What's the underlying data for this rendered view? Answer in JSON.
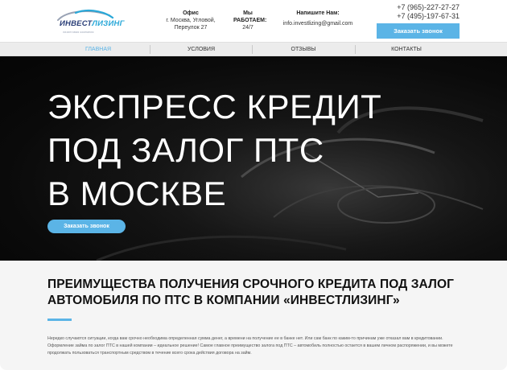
{
  "header": {
    "logo": {
      "name": "ИНВЕСТЛИЗИНГ",
      "part_main": "ИНВЕСТ",
      "part_accent": "ЛИЗИНГ",
      "tagline": "лизинговая компания"
    },
    "office": {
      "title": "Офис",
      "line1": "г. Москва, Угловой,",
      "line2": "Переулок 27"
    },
    "hours": {
      "title1": "Мы",
      "title2": "РАБОТАЕМ:",
      "value": "24/7"
    },
    "mail": {
      "title": "Напишите Нам:",
      "value": "info.investlizing@gmail.com"
    },
    "phones": [
      "+7 (965)-227-27-27",
      "+7 (495)-197-67-31"
    ],
    "call_button": "Заказать звонок"
  },
  "nav": {
    "items": [
      {
        "label": "ГЛАВНАЯ",
        "active": true
      },
      {
        "label": "УСЛОВИЯ",
        "active": false
      },
      {
        "label": "ОТЗЫВЫ",
        "active": false
      },
      {
        "label": "КОНТАКТЫ",
        "active": false
      }
    ]
  },
  "hero": {
    "title_lines": [
      "ЭКСПРЕСС КРЕДИТ",
      "ПОД ЗАЛОГ ПТС",
      "В МОСКВЕ"
    ],
    "button": "Заказать звонок"
  },
  "content": {
    "title": "ПРЕИМУЩЕСТВА ПОЛУЧЕНИЯ СРОЧНОГО КРЕДИТА ПОД ЗАЛОГ АВТОМОБИЛЯ ПО ПТС В КОМПАНИИ «ИНВЕСТЛИЗИНГ»",
    "text": "Нередко случаются ситуации, когда вам срочно необходима определенная сумма денег, а времени на получение ее в банке нет. Или сам банк по каким-то причинам уже отказал вам в кредитовании. Оформление займа по залог ПТС в нашей компании – идеальное решение! Самое главное преимущество залога под ПТС – автомобиль полностью остается в вашем личном распоряжении, и вы можете продолжать пользоваться транспортным средством в течение всего срока действия договора на займ."
  },
  "colors": {
    "accent": "#5bb4e6",
    "logo_dark": "#2b3f78",
    "logo_accent": "#2aa8d8",
    "hero_bg": "#0d0d0d",
    "content_bg": "#f5f5f5"
  }
}
